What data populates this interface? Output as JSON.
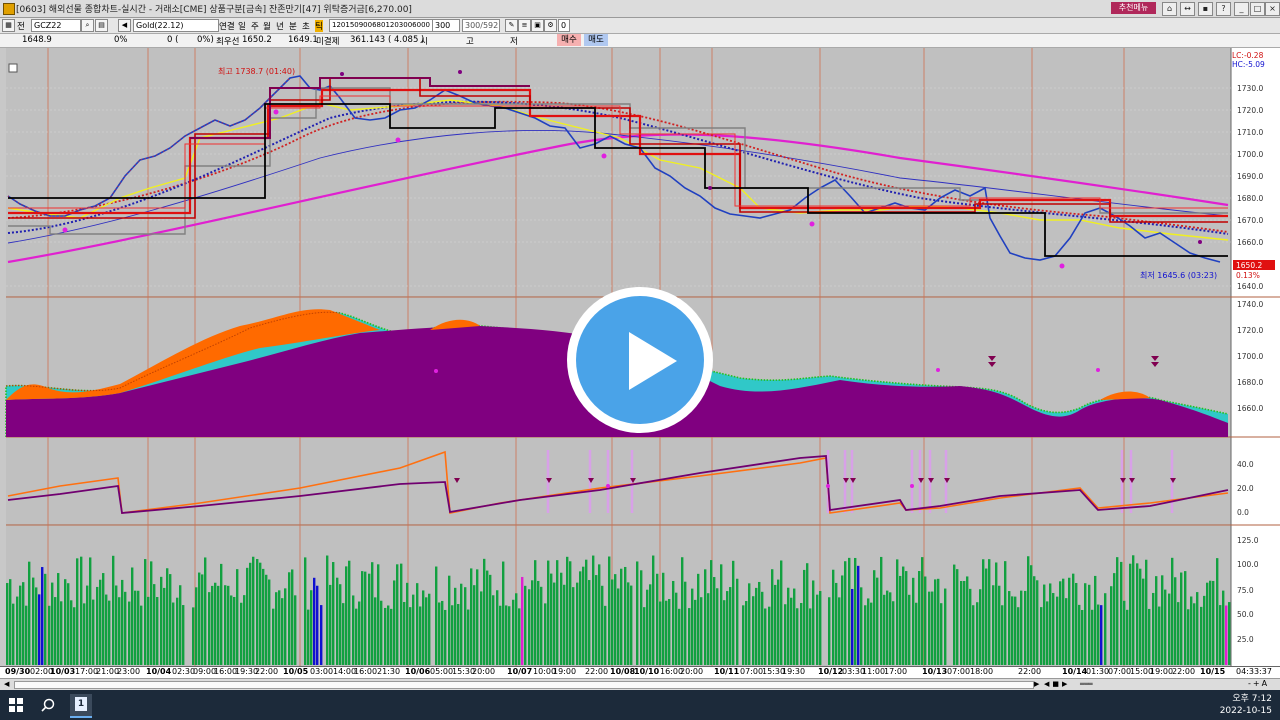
{
  "window": {
    "title": "[0603] 해외선물 종합차트-실시간 - 거래소[CME] 상품구분[금속] 잔존만기[47] 위탁증거금[6,270.00]",
    "recommend_menu": "추천메뉴"
  },
  "toolbar": {
    "mode_label": "전",
    "symbol_code": "GCZ22",
    "symbol_name": "Gold(22.12)",
    "period_labels": [
      "연결",
      "일",
      "주",
      "월",
      "년",
      "분",
      "초",
      "틱"
    ],
    "interval_values": "1201509006801203006000",
    "count_value": "300",
    "page_value": "300/592",
    "checkbox_value": "0"
  },
  "infobar": {
    "price": "1648.9",
    "change_pct": "0%",
    "volume": "0 (",
    "volume_pct": "0%)",
    "best_ask_label": "최우선",
    "best_ask": "1650.2",
    "best_bid": "1649.1",
    "open_interest_label": "미결제",
    "open_interest": "361.143",
    "oi_change": "( 4.085 )",
    "high_low_labels": [
      "시",
      "고",
      "저"
    ],
    "buy_label": "매수",
    "sell_label": "매도"
  },
  "price_panel": {
    "high_annotation": "최고 1738.7 (01:40)",
    "low_annotation": "최저 1645.6 (03:23)",
    "lc_label": "LC:-0.28",
    "hc_label": "HC:-5.09",
    "current_price_tag": "1650.2",
    "current_change_tag": "0.13%",
    "y_ticks": [
      "1730.0",
      "1720.0",
      "1710.0",
      "1700.0",
      "1690.0",
      "1680.0",
      "1670.0",
      "1660.0",
      "1640.0"
    ]
  },
  "volume_profile_panel": {
    "y_ticks": [
      "1740.0",
      "1720.0",
      "1700.0",
      "1680.0",
      "1660.0"
    ]
  },
  "oscillator_panel": {
    "y_ticks": [
      "40.0",
      "20.0",
      "0.0"
    ]
  },
  "volume_panel": {
    "y_ticks": [
      "125.0",
      "100.0",
      "75.0",
      "50.0",
      "25.0"
    ]
  },
  "date_axis": [
    "09/30",
    "02:00",
    "10/03",
    "17:00",
    "21:00",
    "23:00",
    "10/04",
    "02:30",
    "09:00",
    "16:00",
    "19:30",
    "22:00",
    "10/05",
    "03:00",
    "14:00",
    "16:00",
    "21:30",
    "10/06",
    "05:00",
    "15:30",
    "20:00",
    "10/07",
    "10:00",
    "19:00",
    "22:00",
    "10/08",
    "10/10",
    "16:00",
    "20:00",
    "10/11",
    "07:00",
    "15:30",
    "19:30",
    "10/12",
    "03:30",
    "11:00",
    "17:00",
    "10/13",
    "07:00",
    "18:00",
    "22:00",
    "10/14",
    "01:30",
    "07:00",
    "15:00",
    "19:00",
    "22:00",
    "10/15",
    "04:33:37"
  ],
  "clock": {
    "time": "오후 7:12",
    "date": "2022-10-15"
  },
  "taskbar": {
    "app_number": "1"
  },
  "colors": {
    "ma_magenta": "#e020d0",
    "ma_blue": "#3030c0",
    "step_red": "#e01010",
    "step_black": "#000000",
    "volume_green": "#10a040",
    "volume_blue": "#1010d0",
    "profile_purple": "#800080",
    "profile_orange": "#ff6a00",
    "profile_cyan": "#30c8c8",
    "play_blue": "#4aa3e8"
  }
}
